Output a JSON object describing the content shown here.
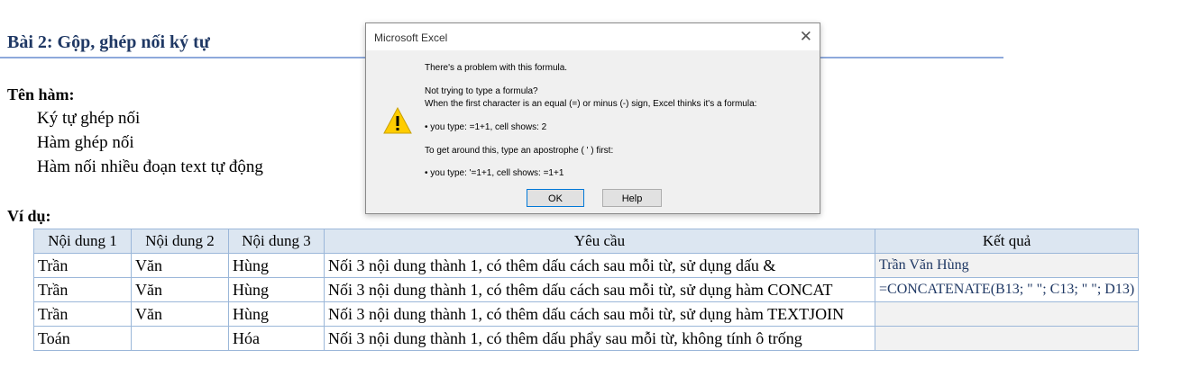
{
  "sheet": {
    "title": "Bài 2: Gộp, ghép nối ký tự",
    "functions_label": "Tên hàm:",
    "functions": [
      "Ký tự ghép nối",
      "Hàm ghép nối",
      "Hàm nối nhiều đoạn text tự động"
    ],
    "example_label": "Ví dụ:"
  },
  "table": {
    "headers": [
      "Nội dung 1",
      "Nội dung 2",
      "Nội dung 3",
      "Yêu cầu",
      "Kết quả"
    ],
    "rows": [
      {
        "c1": "Trần",
        "c2": "Văn",
        "c3": "Hùng",
        "req": "Nối 3 nội dung thành 1, có thêm dấu cách sau mỗi từ, sử dụng dấu &",
        "result": "Trần Văn Hùng"
      },
      {
        "c1": "Trần",
        "c2": "Văn",
        "c3": "Hùng",
        "req": "Nối 3 nội dung thành 1, có thêm dấu cách sau mỗi từ, sử dụng hàm CONCAT",
        "result": "=CONCATENATE(B13; \" \"; C13; \" \"; D13)"
      },
      {
        "c1": "Trần",
        "c2": "Văn",
        "c3": "Hùng",
        "req": "Nối 3 nội dung thành 1, có thêm dấu cách sau mỗi từ, sử dụng hàm TEXTJOIN",
        "result": ""
      },
      {
        "c1": "Toán",
        "c2": "",
        "c3": "Hóa",
        "req": "Nối 3 nội dung thành 1, có thêm dấu phẩy sau mỗi từ, không tính ô trống",
        "result": ""
      }
    ]
  },
  "dialog": {
    "title": "Microsoft Excel",
    "close_glyph": "✕",
    "icon": "warning-icon",
    "lines": [
      "There's a problem with this formula.",
      "Not trying to type a formula?",
      "When the first character is an equal (=) or minus (-) sign, Excel thinks it's a formula:",
      "• you type:   =1+1, cell shows:   2",
      "To get around this, type an apostrophe ( ' ) first:",
      "• you type:   '=1+1, cell shows:   =1+1"
    ],
    "ok_label": "OK",
    "help_label": "Help"
  },
  "colors": {
    "title": "#1f3864",
    "header_bg": "#dce6f1",
    "border": "#9bb7d9",
    "result_bg": "#f2f2f2",
    "warning": "#ffcc00"
  }
}
